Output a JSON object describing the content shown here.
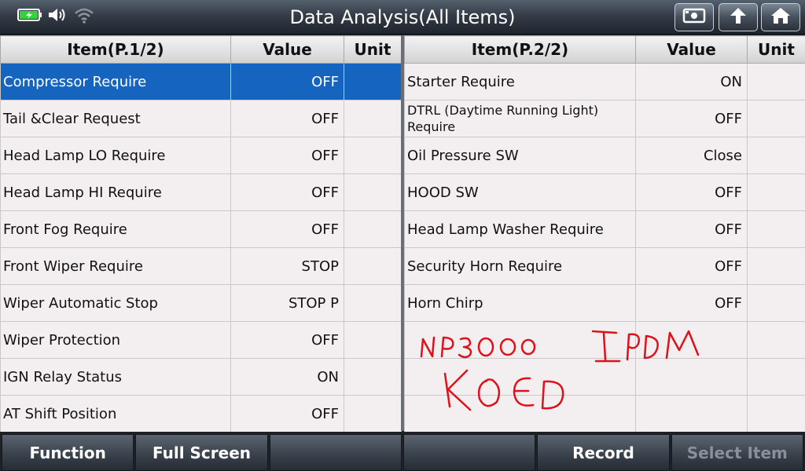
{
  "header": {
    "title": "Data Analysis(All Items)",
    "status_icons": [
      "battery-icon",
      "speaker-icon",
      "wifi-icon"
    ],
    "buttons": [
      "screenshot-icon",
      "back-arrow-icon",
      "home-icon"
    ]
  },
  "columns": {
    "item_p1": "Item(P.1/2)",
    "item_p2": "Item(P.2/2)",
    "value": "Value",
    "unit": "Unit"
  },
  "left_rows": [
    {
      "item": "Compressor Require",
      "value": "OFF",
      "unit": ""
    },
    {
      "item": "Tail &Clear Request",
      "value": "OFF",
      "unit": ""
    },
    {
      "item": "Head Lamp LO Require",
      "value": "OFF",
      "unit": ""
    },
    {
      "item": "Head Lamp HI Require",
      "value": "OFF",
      "unit": ""
    },
    {
      "item": "Front Fog Require",
      "value": "OFF",
      "unit": ""
    },
    {
      "item": "Front Wiper Require",
      "value": "STOP",
      "unit": ""
    },
    {
      "item": "Wiper Automatic Stop",
      "value": "STOP P",
      "unit": ""
    },
    {
      "item": "Wiper Protection",
      "value": "OFF",
      "unit": ""
    },
    {
      "item": "IGN Relay Status",
      "value": "ON",
      "unit": ""
    },
    {
      "item": "AT Shift Position",
      "value": "OFF",
      "unit": ""
    }
  ],
  "right_rows": [
    {
      "item": "Starter Require",
      "value": "ON",
      "unit": ""
    },
    {
      "item": "DTRL (Daytime Running Light) Require",
      "value": "OFF",
      "unit": ""
    },
    {
      "item": "Oil Pressure SW",
      "value": "Close",
      "unit": ""
    },
    {
      "item": "HOOD SW",
      "value": "OFF",
      "unit": ""
    },
    {
      "item": "Head Lamp Washer Require",
      "value": "OFF",
      "unit": ""
    },
    {
      "item": "Security Horn Require",
      "value": "OFF",
      "unit": ""
    },
    {
      "item": "Horn Chirp",
      "value": "OFF",
      "unit": ""
    },
    {
      "item": "",
      "value": "",
      "unit": ""
    },
    {
      "item": "",
      "value": "",
      "unit": ""
    },
    {
      "item": "",
      "value": "",
      "unit": ""
    }
  ],
  "selected_row": 0,
  "annotation": {
    "line1": "NP300",
    "line2": "KOEO",
    "line3": "IPDM",
    "color": "#e0101a"
  },
  "bottom_buttons": [
    "Function",
    "Full Screen",
    "",
    "",
    "Record",
    "Select Item"
  ],
  "colors": {
    "selected": "#1565c0",
    "row_bg": "#f3eff0"
  }
}
